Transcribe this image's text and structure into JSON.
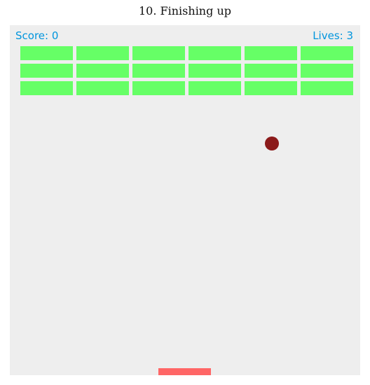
{
  "page": {
    "title": "10. Finishing up"
  },
  "hud": {
    "score_text": "Score: 0",
    "lives_text": "Lives: 3",
    "score": 0,
    "lives": 3,
    "text_color": "#0095dd"
  },
  "game": {
    "background_color": "#eeeeee",
    "brick_rows": 3,
    "brick_columns": 6,
    "bricks_remaining": 18,
    "brick_color": "#66ff66",
    "ball_color": "#8b1a1a",
    "paddle_color": "#ff6666"
  }
}
